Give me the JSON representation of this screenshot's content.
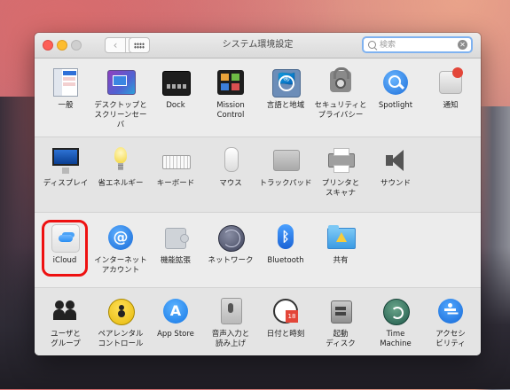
{
  "window": {
    "title": "システム環境設定",
    "nav": {
      "back": "‹",
      "forward": "›"
    },
    "search": {
      "placeholder": "検索",
      "clear": "✕"
    }
  },
  "rows": [
    [
      {
        "label": "一般",
        "icon": "general-icon"
      },
      {
        "label": "デスクトップと\nスクリーンセーバ",
        "icon": "desktop-screensaver-icon"
      },
      {
        "label": "Dock",
        "icon": "dock-icon"
      },
      {
        "label": "Mission\nControl",
        "icon": "mission-control-icon"
      },
      {
        "label": "言語と地域",
        "icon": "language-region-icon"
      },
      {
        "label": "セキュリティと\nプライバシー",
        "icon": "security-privacy-icon"
      },
      {
        "label": "Spotlight",
        "icon": "spotlight-icon"
      },
      {
        "label": "通知",
        "icon": "notifications-icon"
      }
    ],
    [
      {
        "label": "ディスプレイ",
        "icon": "displays-icon"
      },
      {
        "label": "省エネルギー",
        "icon": "energy-saver-icon"
      },
      {
        "label": "キーボード",
        "icon": "keyboard-icon"
      },
      {
        "label": "マウス",
        "icon": "mouse-icon"
      },
      {
        "label": "トラックパッド",
        "icon": "trackpad-icon"
      },
      {
        "label": "プリンタと\nスキャナ",
        "icon": "printers-scanners-icon"
      },
      {
        "label": "サウンド",
        "icon": "sound-icon"
      }
    ],
    [
      {
        "label": "iCloud",
        "icon": "icloud-icon"
      },
      {
        "label": "インターネット\nアカウント",
        "icon": "internet-accounts-icon"
      },
      {
        "label": "機能拡張",
        "icon": "extensions-icon"
      },
      {
        "label": "ネットワーク",
        "icon": "network-icon"
      },
      {
        "label": "Bluetooth",
        "icon": "bluetooth-icon"
      },
      {
        "label": "共有",
        "icon": "sharing-icon"
      }
    ],
    [
      {
        "label": "ユーザと\nグループ",
        "icon": "users-groups-icon"
      },
      {
        "label": "ペアレンタル\nコントロール",
        "icon": "parental-controls-icon"
      },
      {
        "label": "App Store",
        "icon": "app-store-icon"
      },
      {
        "label": "音声入力と\n読み上げ",
        "icon": "dictation-speech-icon"
      },
      {
        "label": "日付と時刻",
        "icon": "date-time-icon"
      },
      {
        "label": "起動\nディスク",
        "icon": "startup-disk-icon"
      },
      {
        "label": "Time\nMachine",
        "icon": "time-machine-icon"
      },
      {
        "label": "アクセシ\nビリティ",
        "icon": "accessibility-icon"
      }
    ]
  ],
  "colors": {
    "highlight_ring": "#ee1111",
    "search_focus": "#7fb2f0",
    "close": "#fd5f57",
    "minimize": "#fdbd2f"
  }
}
